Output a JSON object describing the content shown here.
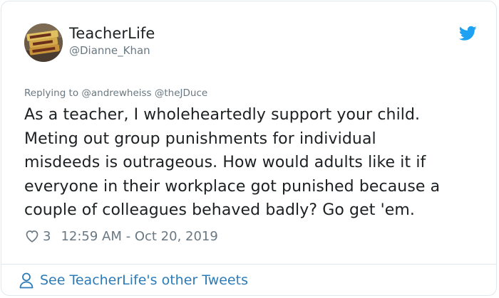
{
  "author": {
    "display_name": "TeacherLife",
    "handle": "@Dianne_Khan",
    "avatar_icon": "avatar-image"
  },
  "reply": {
    "prefix": "Replying to",
    "mentions": [
      "@andrewheiss",
      "@theJDuce"
    ]
  },
  "tweet": {
    "text": "As a teacher, I wholeheartedly support your child.\nMeting out group punishments for individual\nmisdeeds is outrageous. How would adults like it if\neveryone in their workplace got punished because a\ncouple of colleagues behaved badly? Go get 'em.",
    "like_count": "3",
    "timestamp": "12:59 AM - Oct 20, 2019"
  },
  "footer": {
    "link_label": "See TeacherLife's other Tweets"
  },
  "colors": {
    "brand_blue": "#1da1f2",
    "link_blue": "#2b7bb9",
    "secondary_text": "#697882",
    "border": "#e1e8ed"
  }
}
